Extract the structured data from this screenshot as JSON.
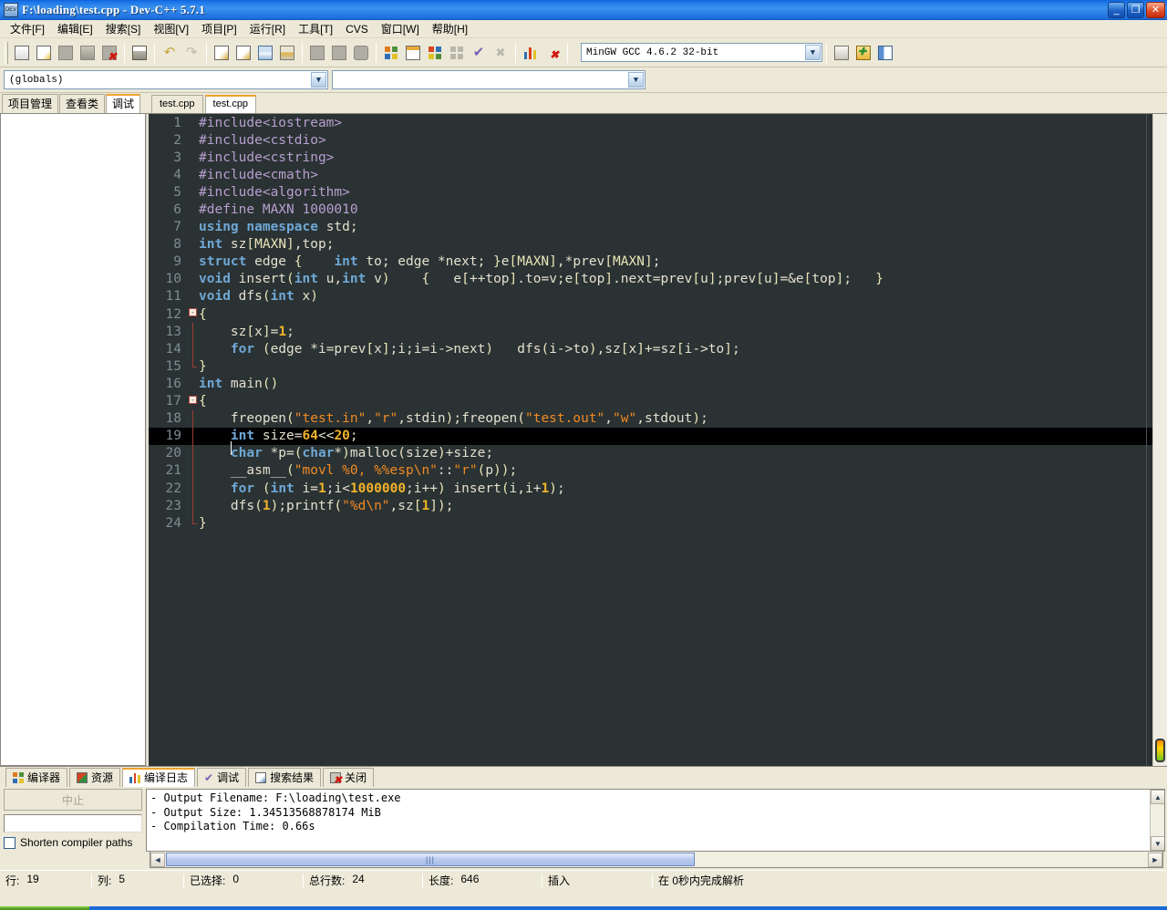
{
  "window": {
    "title": "F:\\loading\\test.cpp - Dev-C++ 5.7.1",
    "minimize_label": "_",
    "maximize_label": "❐",
    "close_label": "✕",
    "app_icon": "dev-cpp-logo"
  },
  "menu": {
    "items": [
      {
        "label": "文件[F]"
      },
      {
        "label": "编辑[E]"
      },
      {
        "label": "搜索[S]"
      },
      {
        "label": "视图[V]"
      },
      {
        "label": "项目[P]"
      },
      {
        "label": "运行[R]"
      },
      {
        "label": "工具[T]"
      },
      {
        "label": "CVS"
      },
      {
        "label": "窗口[W]"
      },
      {
        "label": "帮助[H]"
      }
    ]
  },
  "toolbar": {
    "compiler_value": "MinGW GCC 4.6.2 32-bit",
    "buttons": [
      {
        "name": "new-file-button"
      },
      {
        "name": "open-file-button"
      },
      {
        "name": "save-file-button"
      },
      {
        "name": "save-all-button"
      },
      {
        "name": "close-file-button"
      },
      {
        "name": "print-button"
      },
      {
        "name": "undo-button"
      },
      {
        "name": "redo-button"
      },
      {
        "name": "find-button"
      },
      {
        "name": "replace-button"
      },
      {
        "name": "goto-line-button"
      },
      {
        "name": "goto-function-button"
      },
      {
        "name": "back-button"
      },
      {
        "name": "forward-button"
      },
      {
        "name": "insert-template-button"
      },
      {
        "name": "compile-button"
      },
      {
        "name": "run-button"
      },
      {
        "name": "compile-run-button"
      },
      {
        "name": "rebuild-all-button"
      },
      {
        "name": "syntax-check-button"
      },
      {
        "name": "stop-execution-button"
      },
      {
        "name": "profile-button"
      },
      {
        "name": "delete-profile-button"
      },
      {
        "name": "new-window-button"
      },
      {
        "name": "add-to-project-button"
      },
      {
        "name": "toggle-panel-button"
      }
    ]
  },
  "browser": {
    "scope_value": "(globals)",
    "symbol_value": ""
  },
  "left_panel": {
    "tabs": [
      {
        "label": "项目管理",
        "active": false
      },
      {
        "label": "查看类",
        "active": false
      },
      {
        "label": "调试",
        "active": true
      }
    ]
  },
  "editor": {
    "tabs": [
      {
        "label": "test.cpp",
        "active": false
      },
      {
        "label": "test.cpp",
        "active": true
      }
    ],
    "highlight_line": 19,
    "colors": {
      "background": "#2b3233",
      "text": "#e3e0cf",
      "linenumber": "#7c8e92",
      "keyword": "#6fa8d6",
      "preprocessor": "#b79fd0",
      "string": "#f08a24",
      "number": "#f0b429",
      "current_line_bg": "#000000"
    },
    "lines": [
      {
        "n": 1,
        "fold": "",
        "tokens": [
          {
            "t": "#include<iostream>",
            "c": "pre"
          }
        ]
      },
      {
        "n": 2,
        "fold": "",
        "tokens": [
          {
            "t": "#include<cstdio>",
            "c": "pre"
          }
        ]
      },
      {
        "n": 3,
        "fold": "",
        "tokens": [
          {
            "t": "#include<cstring>",
            "c": "pre"
          }
        ]
      },
      {
        "n": 4,
        "fold": "",
        "tokens": [
          {
            "t": "#include<cmath>",
            "c": "pre"
          }
        ]
      },
      {
        "n": 5,
        "fold": "",
        "tokens": [
          {
            "t": "#include<algorithm>",
            "c": "pre"
          }
        ]
      },
      {
        "n": 6,
        "fold": "",
        "tokens": [
          {
            "t": "#define MAXN ",
            "c": "pre"
          },
          {
            "t": "1000010",
            "c": "pre"
          }
        ]
      },
      {
        "n": 7,
        "fold": "",
        "tokens": [
          {
            "t": "using namespace ",
            "c": "kw"
          },
          {
            "t": "std;",
            "c": "id"
          }
        ]
      },
      {
        "n": 8,
        "fold": "",
        "tokens": [
          {
            "t": "int",
            "c": "kw"
          },
          {
            "t": " sz",
            "c": "id"
          },
          {
            "t": "[MAXN]",
            "c": "brk"
          },
          {
            "t": ",top;",
            "c": "id"
          }
        ]
      },
      {
        "n": 9,
        "fold": "",
        "tokens": [
          {
            "t": "struct",
            "c": "kw"
          },
          {
            "t": " edge ",
            "c": "id"
          },
          {
            "t": "{",
            "c": "brk"
          },
          {
            "t": "    ",
            "c": "id"
          },
          {
            "t": "int",
            "c": "kw"
          },
          {
            "t": " to; edge *next; ",
            "c": "id"
          },
          {
            "t": "}",
            "c": "brk"
          },
          {
            "t": "e",
            "c": "id"
          },
          {
            "t": "[MAXN]",
            "c": "brk"
          },
          {
            "t": ",*prev",
            "c": "id"
          },
          {
            "t": "[MAXN]",
            "c": "brk"
          },
          {
            "t": ";",
            "c": "id"
          }
        ]
      },
      {
        "n": 10,
        "fold": "",
        "tokens": [
          {
            "t": "void",
            "c": "kw"
          },
          {
            "t": " insert",
            "c": "id"
          },
          {
            "t": "(",
            "c": "brk"
          },
          {
            "t": "int",
            "c": "kw"
          },
          {
            "t": " u,",
            "c": "id"
          },
          {
            "t": "int",
            "c": "kw"
          },
          {
            "t": " v",
            "c": "id"
          },
          {
            "t": ")",
            "c": "brk"
          },
          {
            "t": "    ",
            "c": "id"
          },
          {
            "t": "{",
            "c": "brk"
          },
          {
            "t": "   e",
            "c": "id"
          },
          {
            "t": "[",
            "c": "brk"
          },
          {
            "t": "++top",
            "c": "id"
          },
          {
            "t": "]",
            "c": "brk"
          },
          {
            "t": ".to=v;e",
            "c": "id"
          },
          {
            "t": "[",
            "c": "brk"
          },
          {
            "t": "top",
            "c": "id"
          },
          {
            "t": "]",
            "c": "brk"
          },
          {
            "t": ".next=prev",
            "c": "id"
          },
          {
            "t": "[",
            "c": "brk"
          },
          {
            "t": "u",
            "c": "id"
          },
          {
            "t": "]",
            "c": "brk"
          },
          {
            "t": ";prev",
            "c": "id"
          },
          {
            "t": "[",
            "c": "brk"
          },
          {
            "t": "u",
            "c": "id"
          },
          {
            "t": "]",
            "c": "brk"
          },
          {
            "t": "=&e",
            "c": "id"
          },
          {
            "t": "[",
            "c": "brk"
          },
          {
            "t": "top",
            "c": "id"
          },
          {
            "t": "]",
            "c": "brk"
          },
          {
            "t": ";   ",
            "c": "id"
          },
          {
            "t": "}",
            "c": "brk"
          }
        ]
      },
      {
        "n": 11,
        "fold": "",
        "tokens": [
          {
            "t": "void",
            "c": "kw"
          },
          {
            "t": " dfs",
            "c": "id"
          },
          {
            "t": "(",
            "c": "brk"
          },
          {
            "t": "int",
            "c": "kw"
          },
          {
            "t": " x",
            "c": "id"
          },
          {
            "t": ")",
            "c": "brk"
          }
        ]
      },
      {
        "n": 12,
        "fold": "start",
        "tokens": [
          {
            "t": "{",
            "c": "brk"
          }
        ]
      },
      {
        "n": 13,
        "fold": "mid",
        "tokens": [
          {
            "t": "    sz",
            "c": "id"
          },
          {
            "t": "[",
            "c": "brk"
          },
          {
            "t": "x",
            "c": "id"
          },
          {
            "t": "]",
            "c": "brk"
          },
          {
            "t": "=",
            "c": "id"
          },
          {
            "t": "1",
            "c": "num"
          },
          {
            "t": ";",
            "c": "id"
          }
        ]
      },
      {
        "n": 14,
        "fold": "mid",
        "tokens": [
          {
            "t": "    ",
            "c": "id"
          },
          {
            "t": "for",
            "c": "kw"
          },
          {
            "t": " ",
            "c": "id"
          },
          {
            "t": "(",
            "c": "brk"
          },
          {
            "t": "edge *i=prev",
            "c": "id"
          },
          {
            "t": "[",
            "c": "brk"
          },
          {
            "t": "x",
            "c": "id"
          },
          {
            "t": "]",
            "c": "brk"
          },
          {
            "t": ";i;i=i->next",
            "c": "id"
          },
          {
            "t": ")",
            "c": "brk"
          },
          {
            "t": "   dfs",
            "c": "id"
          },
          {
            "t": "(",
            "c": "brk"
          },
          {
            "t": "i->to",
            "c": "id"
          },
          {
            "t": ")",
            "c": "brk"
          },
          {
            "t": ",sz",
            "c": "id"
          },
          {
            "t": "[",
            "c": "brk"
          },
          {
            "t": "x",
            "c": "id"
          },
          {
            "t": "]",
            "c": "brk"
          },
          {
            "t": "+=sz",
            "c": "id"
          },
          {
            "t": "[",
            "c": "brk"
          },
          {
            "t": "i->to",
            "c": "id"
          },
          {
            "t": "]",
            "c": "brk"
          },
          {
            "t": ";",
            "c": "id"
          }
        ]
      },
      {
        "n": 15,
        "fold": "end",
        "tokens": [
          {
            "t": "}",
            "c": "brk"
          }
        ]
      },
      {
        "n": 16,
        "fold": "",
        "tokens": [
          {
            "t": "int",
            "c": "kw"
          },
          {
            "t": " main",
            "c": "id"
          },
          {
            "t": "()",
            "c": "brk"
          }
        ]
      },
      {
        "n": 17,
        "fold": "start",
        "tokens": [
          {
            "t": "{",
            "c": "brk"
          }
        ]
      },
      {
        "n": 18,
        "fold": "mid",
        "tokens": [
          {
            "t": "    freopen",
            "c": "id"
          },
          {
            "t": "(",
            "c": "brk"
          },
          {
            "t": "\"test.in\"",
            "c": "str"
          },
          {
            "t": ",",
            "c": "id"
          },
          {
            "t": "\"r\"",
            "c": "str"
          },
          {
            "t": ",stdin",
            "c": "id"
          },
          {
            "t": ")",
            "c": "brk"
          },
          {
            "t": ";freopen",
            "c": "id"
          },
          {
            "t": "(",
            "c": "brk"
          },
          {
            "t": "\"test.out\"",
            "c": "str"
          },
          {
            "t": ",",
            "c": "id"
          },
          {
            "t": "\"w\"",
            "c": "str"
          },
          {
            "t": ",stdout",
            "c": "id"
          },
          {
            "t": ")",
            "c": "brk"
          },
          {
            "t": ";",
            "c": "id"
          }
        ]
      },
      {
        "n": 19,
        "fold": "mid",
        "tokens": [
          {
            "t": "    ",
            "c": "id"
          },
          {
            "t": "int",
            "c": "kw"
          },
          {
            "t": " size=",
            "c": "id"
          },
          {
            "t": "64",
            "c": "num"
          },
          {
            "t": "<<",
            "c": "id"
          },
          {
            "t": "20",
            "c": "num"
          },
          {
            "t": ";",
            "c": "id"
          }
        ]
      },
      {
        "n": 20,
        "fold": "mid",
        "tokens": [
          {
            "t": "    ",
            "c": "id"
          },
          {
            "t": "char",
            "c": "kw"
          },
          {
            "t": " *p=",
            "c": "id"
          },
          {
            "t": "(",
            "c": "brk"
          },
          {
            "t": "char",
            "c": "kw"
          },
          {
            "t": "*",
            "c": "id"
          },
          {
            "t": ")",
            "c": "brk"
          },
          {
            "t": "malloc",
            "c": "id"
          },
          {
            "t": "(",
            "c": "brk"
          },
          {
            "t": "size",
            "c": "id"
          },
          {
            "t": ")",
            "c": "brk"
          },
          {
            "t": "+size;",
            "c": "id"
          }
        ]
      },
      {
        "n": 21,
        "fold": "mid",
        "tokens": [
          {
            "t": "    __asm__",
            "c": "id"
          },
          {
            "t": "(",
            "c": "brk"
          },
          {
            "t": "\"movl %0, %%esp\\n\"",
            "c": "str"
          },
          {
            "t": "::",
            "c": "id"
          },
          {
            "t": "\"r\"",
            "c": "str"
          },
          {
            "t": "(",
            "c": "brk"
          },
          {
            "t": "p",
            "c": "id"
          },
          {
            "t": "))",
            "c": "brk"
          },
          {
            "t": ";",
            "c": "id"
          }
        ]
      },
      {
        "n": 22,
        "fold": "mid",
        "tokens": [
          {
            "t": "    ",
            "c": "id"
          },
          {
            "t": "for",
            "c": "kw"
          },
          {
            "t": " ",
            "c": "id"
          },
          {
            "t": "(",
            "c": "brk"
          },
          {
            "t": "int",
            "c": "kw"
          },
          {
            "t": " i=",
            "c": "id"
          },
          {
            "t": "1",
            "c": "num"
          },
          {
            "t": ";i<",
            "c": "id"
          },
          {
            "t": "1000000",
            "c": "num"
          },
          {
            "t": ";i++",
            "c": "id"
          },
          {
            "t": ")",
            "c": "brk"
          },
          {
            "t": " insert",
            "c": "id"
          },
          {
            "t": "(",
            "c": "brk"
          },
          {
            "t": "i,i+",
            "c": "id"
          },
          {
            "t": "1",
            "c": "num"
          },
          {
            "t": ")",
            "c": "brk"
          },
          {
            "t": ";",
            "c": "id"
          }
        ]
      },
      {
        "n": 23,
        "fold": "mid",
        "tokens": [
          {
            "t": "    dfs",
            "c": "id"
          },
          {
            "t": "(",
            "c": "brk"
          },
          {
            "t": "1",
            "c": "num"
          },
          {
            "t": ")",
            "c": "brk"
          },
          {
            "t": ";printf",
            "c": "id"
          },
          {
            "t": "(",
            "c": "brk"
          },
          {
            "t": "\"%d\\n\"",
            "c": "str"
          },
          {
            "t": ",sz",
            "c": "id"
          },
          {
            "t": "[",
            "c": "brk"
          },
          {
            "t": "1",
            "c": "num"
          },
          {
            "t": "]",
            "c": "brk"
          },
          {
            "t": ")",
            "c": "brk"
          },
          {
            "t": ";",
            "c": "id"
          }
        ]
      },
      {
        "n": 24,
        "fold": "end",
        "tokens": [
          {
            "t": "}",
            "c": "brk"
          }
        ]
      }
    ]
  },
  "bottom_panel": {
    "tabs": [
      {
        "label": "编译器",
        "icon": "compiler-icon",
        "active": false
      },
      {
        "label": "资源",
        "icon": "resource-icon",
        "active": false
      },
      {
        "label": "编译日志",
        "icon": "log-icon",
        "active": true
      },
      {
        "label": "调试",
        "icon": "debug-icon",
        "active": false
      },
      {
        "label": "搜索结果",
        "icon": "search-results-icon",
        "active": false
      },
      {
        "label": "关闭",
        "icon": "close-panel-icon",
        "active": false
      }
    ],
    "abort_label": "中止",
    "field_value": "",
    "checkbox_label": "Shorten compiler paths",
    "checkbox_checked": false,
    "log_lines": [
      "- Output Filename: F:\\loading\\test.exe",
      "- Output Size: 1.34513568878174 MiB",
      "- Compilation Time: 0.66s"
    ]
  },
  "status_bar": {
    "row_label": "行:",
    "row_value": "19",
    "col_label": "列:",
    "col_value": "5",
    "sel_label": "已选择:",
    "sel_value": "0",
    "total_label": "总行数:",
    "total_value": "24",
    "len_label": "长度:",
    "len_value": "646",
    "mode": "插入",
    "parse_message": "在 0秒内完成解析"
  }
}
